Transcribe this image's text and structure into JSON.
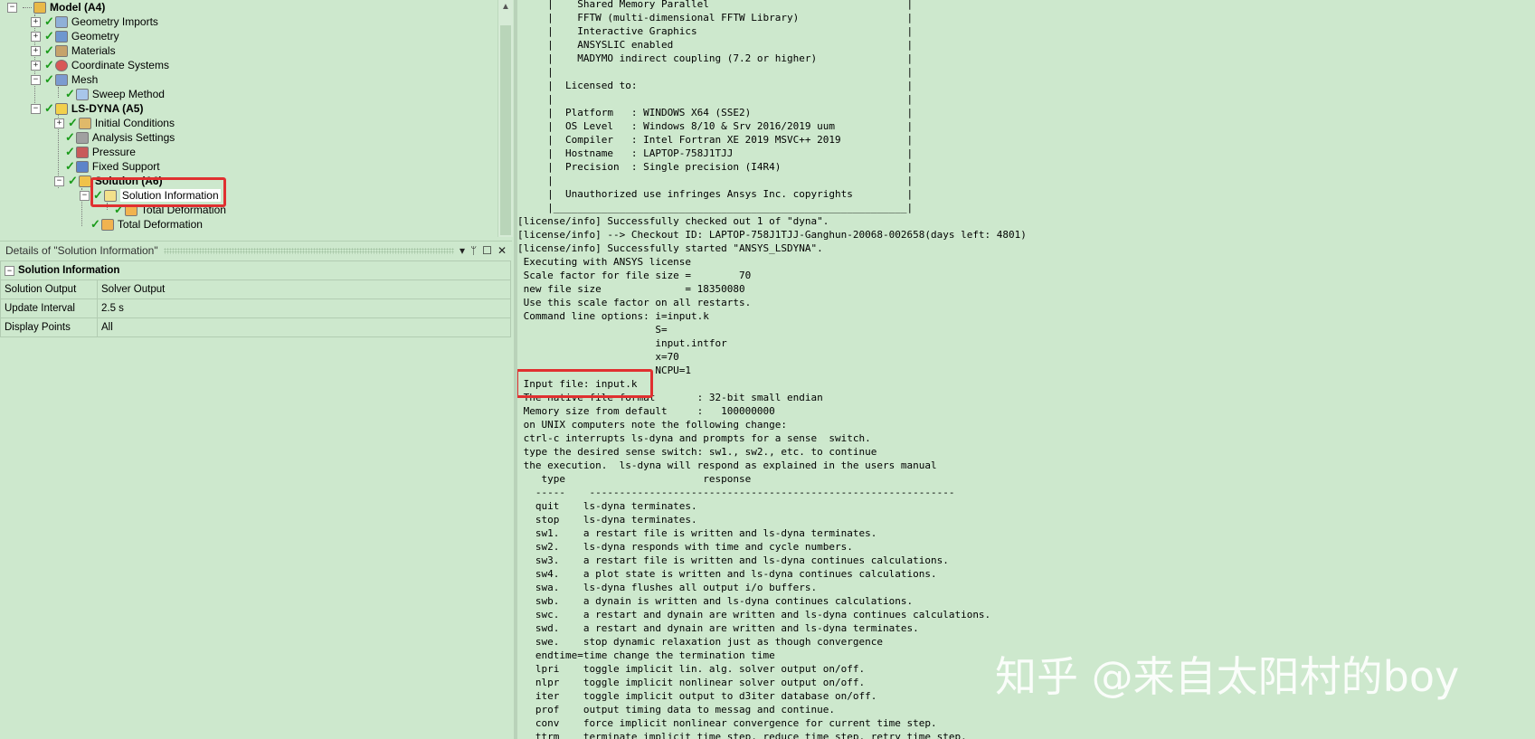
{
  "tree": {
    "nodes": [
      {
        "label": "Model (A4)",
        "icon": "model-icon"
      },
      {
        "label": "Geometry Imports",
        "icon": "geometry-imports-icon"
      },
      {
        "label": "Geometry",
        "icon": "geometry-icon"
      },
      {
        "label": "Materials",
        "icon": "materials-icon"
      },
      {
        "label": "Coordinate Systems",
        "icon": "coordinate-systems-icon"
      },
      {
        "label": "Mesh",
        "icon": "mesh-icon"
      },
      {
        "label": "Sweep Method",
        "icon": "sweep-method-icon"
      },
      {
        "label": "LS-DYNA (A5)",
        "icon": "lsdyna-icon"
      },
      {
        "label": "Initial Conditions",
        "icon": "initial-conditions-icon"
      },
      {
        "label": "Analysis Settings",
        "icon": "analysis-settings-icon"
      },
      {
        "label": "Pressure",
        "icon": "pressure-icon"
      },
      {
        "label": "Fixed Support",
        "icon": "fixed-support-icon"
      },
      {
        "label": "Solution (A6)",
        "icon": "solution-icon"
      },
      {
        "label": "Solution Information",
        "icon": "solution-information-icon"
      },
      {
        "label": "Total Deformation",
        "icon": "total-deformation-icon"
      },
      {
        "label": "Total Deformation",
        "icon": "total-deformation-icon"
      }
    ]
  },
  "details": {
    "title": "Details of \"Solution Information\"",
    "controls": {
      "dropdown": "▾",
      "pin": "ᛘ",
      "maximize": "☐",
      "close": "✕"
    },
    "section": "Solution Information",
    "rows": [
      {
        "key": "Solution Output",
        "value": "Solver Output"
      },
      {
        "key": "Update Interval",
        "value": "2.5 s"
      },
      {
        "key": "Display Points",
        "value": "All"
      }
    ]
  },
  "console": {
    "lines": [
      "     |    Shared Memory Parallel                                 |",
      "     |    FFTW (multi-dimensional FFTW Library)                  |",
      "     |    Interactive Graphics                                   |",
      "     |    ANSYSLIC enabled                                       |",
      "     |    MADYMO indirect coupling (7.2 or higher)               |",
      "     |                                                           |",
      "     |  Licensed to:                                             |",
      "     |                                                           |",
      "     |  Platform   : WINDOWS X64 (SSE2)                          |",
      "     |  OS Level   : Windows 8/10 & Srv 2016/2019 uum            |",
      "     |  Compiler   : Intel Fortran XE 2019 MSVC++ 2019           |",
      "     |  Hostname   : LAPTOP-758J1TJJ                             |",
      "     |  Precision  : Single precision (I4R4)                     |",
      "     |                                                           |",
      "     |  Unauthorized use infringes Ansys Inc. copyrights         |",
      "     |___________________________________________________________|",
      "[license/info] Successfully checked out 1 of \"dyna\".",
      "[license/info] --> Checkout ID: LAPTOP-758J1TJJ-Ganghun-20068-002658(days left: 4801)",
      "[license/info] Successfully started \"ANSYS_LSDYNA\".",
      " Executing with ANSYS license",
      " Scale factor for file size =        70",
      " new file size              = 18350080",
      " Use this scale factor on all restarts.",
      " Command line options: i=input.k",
      "                       S=",
      "                       input.intfor",
      "                       x=70",
      "                       NCPU=1",
      " Input file: input.k",
      " The native file format       : 32-bit small endian",
      " Memory size from default     :   100000000",
      " on UNIX computers note the following change:",
      " ctrl-c interrupts ls-dyna and prompts for a sense  switch.",
      " type the desired sense switch: sw1., sw2., etc. to continue",
      " the execution.  ls-dyna will respond as explained in the users manual",
      "    type                       response",
      "   -----    -------------------------------------------------------------",
      "   quit    ls-dyna terminates.",
      "   stop    ls-dyna terminates.",
      "   sw1.    a restart file is written and ls-dyna terminates.",
      "   sw2.    ls-dyna responds with time and cycle numbers.",
      "   sw3.    a restart file is written and ls-dyna continues calculations.",
      "   sw4.    a plot state is written and ls-dyna continues calculations.",
      "   swa.    ls-dyna flushes all output i/o buffers.",
      "   swb.    a dynain is written and ls-dyna continues calculations.",
      "   swc.    a restart and dynain are written and ls-dyna continues calculations.",
      "   swd.    a restart and dynain are written and ls-dyna terminates.",
      "   swe.    stop dynamic relaxation just as though convergence",
      "   endtime=time change the termination time",
      "   lpri    toggle implicit lin. alg. solver output on/off.",
      "   nlpr    toggle implicit nonlinear solver output on/off.",
      "   iter    toggle implicit output to d3iter database on/off.",
      "   prof    output timing data to messag and continue.",
      "   conv    force implicit nonlinear convergence for current time step.",
      "   ttrm    terminate implicit time step, reduce time step, retry time step."
    ]
  },
  "watermark": "知乎 @来自太阳村的boy",
  "colors": {
    "background": "#cde8cd",
    "highlight": "#e03030",
    "check": "#1a9b1a"
  }
}
